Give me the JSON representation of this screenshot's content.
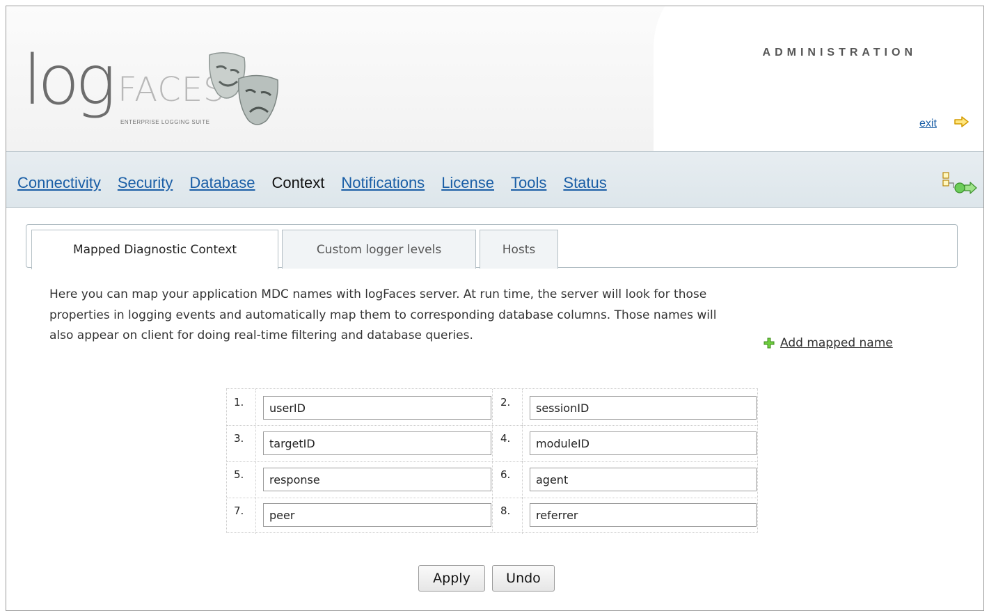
{
  "header": {
    "logo_main": "log",
    "logo_faces": "FACES",
    "logo_subtitle": "ENTERPRISE LOGGING SUITE",
    "admin_title": "ADMINISTRATION",
    "exit_label": "exit"
  },
  "nav": {
    "items": [
      {
        "label": "Connectivity"
      },
      {
        "label": "Security"
      },
      {
        "label": "Database"
      },
      {
        "label": "Context",
        "active": true
      },
      {
        "label": "Notifications"
      },
      {
        "label": "License"
      },
      {
        "label": "Tools"
      },
      {
        "label": "Status"
      }
    ]
  },
  "tabs": [
    {
      "label": "Mapped Diagnostic Context",
      "active": true
    },
    {
      "label": "Custom logger levels"
    },
    {
      "label": "Hosts"
    }
  ],
  "description": {
    "line1": "Here you can map your application MDC names with logFaces server. At run time, the server will look for those",
    "line2": "properties in logging events and automatically map them to corresponding database columns. Those names will",
    "line3": "also appear on client for doing real-time filtering and database queries."
  },
  "add_link": "Add mapped name",
  "mappings": [
    {
      "num": "1.",
      "value": "userID"
    },
    {
      "num": "2.",
      "value": "sessionID"
    },
    {
      "num": "3.",
      "value": "targetID"
    },
    {
      "num": "4.",
      "value": "moduleID"
    },
    {
      "num": "5.",
      "value": "response"
    },
    {
      "num": "6.",
      "value": "agent"
    },
    {
      "num": "7.",
      "value": "peer"
    },
    {
      "num": "8.",
      "value": "referrer"
    }
  ],
  "buttons": {
    "apply": "Apply",
    "undo": "Undo"
  },
  "colors": {
    "link": "#1a5ea6",
    "nav_bg": "#e2e9ee",
    "border": "#a9b6bd"
  }
}
